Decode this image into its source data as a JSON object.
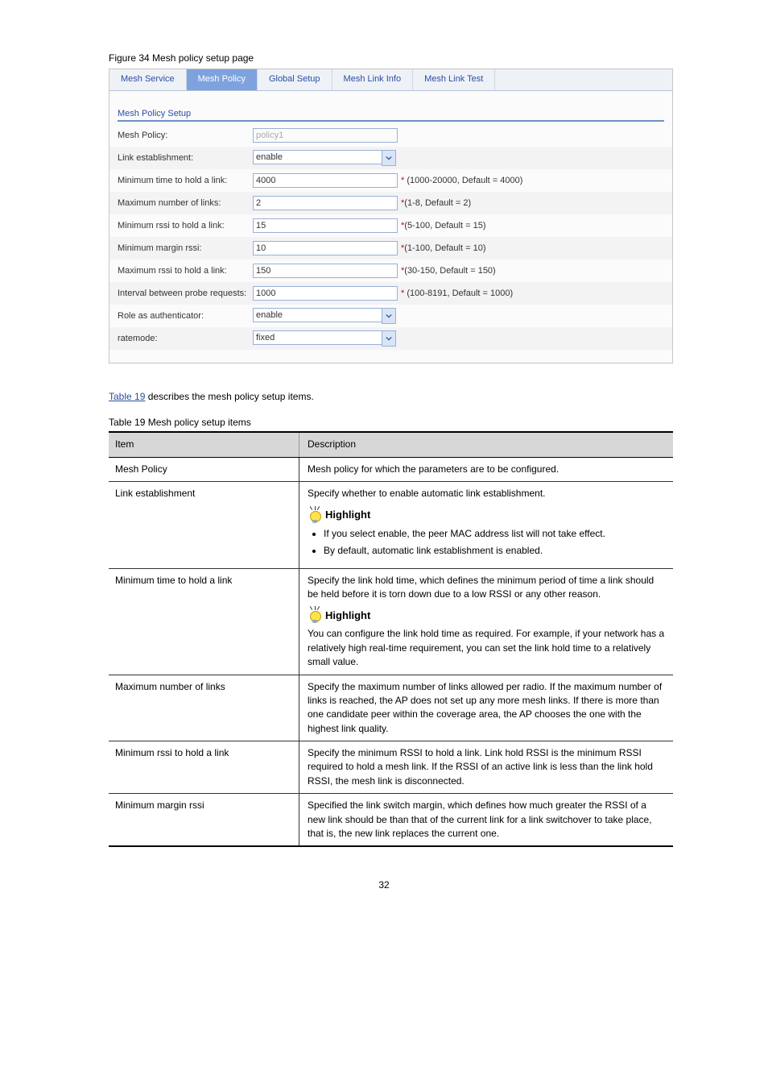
{
  "figure_caption": "Figure 34 Mesh policy setup page",
  "tabs": [
    "Mesh Service",
    "Mesh Policy",
    "Global Setup",
    "Mesh Link Info",
    "Mesh Link Test"
  ],
  "section_title": "Mesh Policy Setup",
  "form": [
    {
      "label": "Mesh Policy:",
      "type": "text",
      "value": "policy1",
      "disabled": true
    },
    {
      "label": "Link establishment:",
      "type": "select",
      "value": "enable"
    },
    {
      "label": "Minimum time to hold a link:",
      "type": "text",
      "value": "4000",
      "hint": " (1000-20000, Default = 4000)"
    },
    {
      "label": "Maximum number of links:",
      "type": "text",
      "value": "2",
      "hint": "(1-8, Default = 2)"
    },
    {
      "label": "Minimum rssi to hold a link:",
      "type": "text",
      "value": "15",
      "hint": "(5-100, Default = 15)"
    },
    {
      "label": "Minimum margin rssi:",
      "type": "text",
      "value": "10",
      "hint": "(1-100, Default = 10)"
    },
    {
      "label": "Maximum rssi to hold a link:",
      "type": "text",
      "value": "150",
      "hint": "(30-150, Default = 150)"
    },
    {
      "label": "Interval between probe requests:",
      "type": "text",
      "value": "1000",
      "hint": " (100-8191, Default = 1000)"
    },
    {
      "label": "Role as authenticator:",
      "type": "select",
      "value": "enable"
    },
    {
      "label": "ratemode:",
      "type": "select",
      "value": "fixed"
    }
  ],
  "table_link": "Table 19",
  "table_link_after": " describes the mesh policy setup items.",
  "table_caption": "Table 19 Mesh policy setup items",
  "header": {
    "left": "Item",
    "right": "Description"
  },
  "rows": [
    {
      "left": "Mesh Policy",
      "right_plain": "Mesh policy for which the parameters are to be configured."
    },
    {
      "left": "Link establishment",
      "right_before": "Specify whether to enable automatic link establishment.",
      "highlight": true,
      "bullets": [
        "If you select enable, the peer MAC address list will not take effect.",
        "By default, automatic link establishment is enabled."
      ]
    },
    {
      "left": "Minimum time to hold a link",
      "right_before": "Specify the link hold time, which defines the minimum period of time a link should be held before it is torn down due to a low RSSI or any other reason.",
      "highlight": true,
      "after_highlight": "You can configure the link hold time as required. For example, if your network has a relatively high real-time requirement, you can set the link hold time to a relatively small value."
    },
    {
      "left": "Maximum number of links",
      "right_plain": "Specify the maximum number of links allowed per radio. If the maximum number of links is reached, the AP does not set up any more mesh links. If there is more than one candidate peer within the coverage area, the AP chooses the one with the highest link quality."
    },
    {
      "left": "Minimum rssi to hold a link",
      "right_plain": "Specify the minimum RSSI to hold a link. Link hold RSSI is the minimum RSSI required to hold a mesh link. If the RSSI of an active link is less than the link hold RSSI, the mesh link is disconnected."
    },
    {
      "left": "Minimum margin rssi",
      "right_plain": "Specified the link switch margin, which defines how much greater the RSSI of a new link should be than that of the current link for a link switchover to take place, that is, the new link replaces the current one."
    }
  ],
  "page_number": "32"
}
